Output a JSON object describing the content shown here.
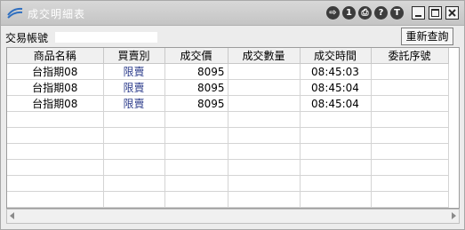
{
  "window": {
    "title": "成交明細表"
  },
  "title_buttons": [
    {
      "icon": "export-icon",
      "glyph": "⇨"
    },
    {
      "icon": "one-icon",
      "glyph": "1"
    },
    {
      "icon": "print-icon",
      "glyph": "⎙"
    },
    {
      "icon": "help-icon",
      "glyph": "?"
    },
    {
      "icon": "t-icon",
      "glyph": "T"
    }
  ],
  "toolbar": {
    "account_label": "交易帳號",
    "requery_label": "重新查詢"
  },
  "table": {
    "columns": [
      "商品名稱",
      "買賣別",
      "成交價",
      "成交數量",
      "成交時間",
      "委託序號"
    ],
    "rows": [
      {
        "product": "台指期08",
        "side": "限賣",
        "price": "8095",
        "qty": "",
        "time": "08:45:03",
        "order_no": ""
      },
      {
        "product": "台指期08",
        "side": "限賣",
        "price": "8095",
        "qty": "",
        "time": "08:45:04",
        "order_no": ""
      },
      {
        "product": "台指期08",
        "side": "限賣",
        "price": "8095",
        "qty": "",
        "time": "08:45:04",
        "order_no": ""
      }
    ]
  }
}
